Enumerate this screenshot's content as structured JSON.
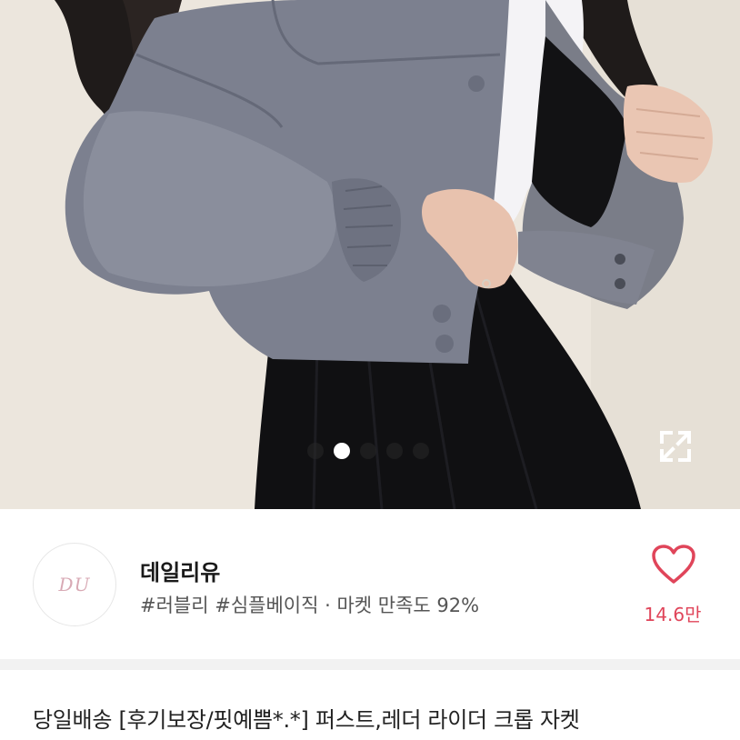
{
  "gallery": {
    "image_alt": "gray leather crop rider jacket worn with black pleated skirt",
    "page_dots": 5,
    "active_dot": 2,
    "expand_icon": "expand-icon"
  },
  "shop": {
    "logo_text": "DU",
    "name": "데일리유",
    "tags": "#러블리 #심플베이직 · 마켓 만족도 92%"
  },
  "like": {
    "icon": "heart-icon",
    "count": "14.6만",
    "color": "#e0455a"
  },
  "product": {
    "title": "당일배송 [후기보장/핏예쁨*.*] 퍼스트,레더 라이더 크롭 자켓"
  }
}
